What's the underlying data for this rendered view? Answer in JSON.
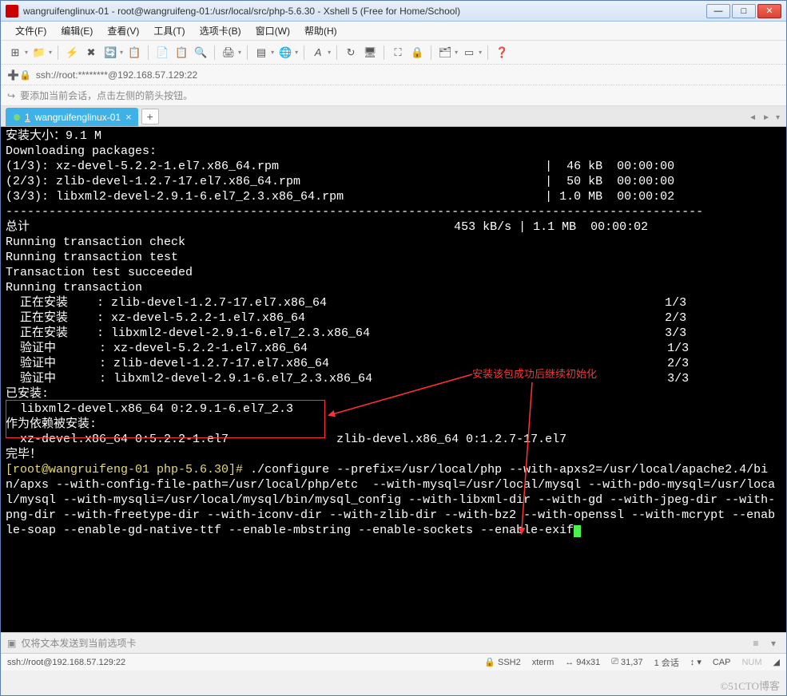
{
  "window": {
    "title": "wangruifenglinux-01 - root@wangruifeng-01:/usr/local/src/php-5.6.30 - Xshell 5 (Free for Home/School)"
  },
  "menu": {
    "file": "文件(F)",
    "edit": "编辑(E)",
    "view": "查看(V)",
    "tools": "工具(T)",
    "options": "选项卡(B)",
    "window": "窗口(W)",
    "help": "帮助(H)"
  },
  "address": "ssh://root:********@192.168.57.129:22",
  "hint": "要添加当前会话，点击左侧的箭头按钮。",
  "tab": {
    "index": "1",
    "label": "wangruifenglinux-01"
  },
  "terminal_lines": {
    "l1": "安装大小：9.1 M",
    "l2": "Downloading packages:",
    "l3": "(1/3): xz-devel-5.2.2-1.el7.x86_64.rpm                                     |  46 kB  00:00:00",
    "l4": "(2/3): zlib-devel-1.2.7-17.el7.x86_64.rpm                                  |  50 kB  00:00:00",
    "l5": "(3/3): libxml2-devel-2.9.1-6.el7_2.3.x86_64.rpm                            | 1.0 MB  00:00:02",
    "dash": "-------------------------------------------------------------------------------------------------",
    "l6": "总计                                                           453 kB/s | 1.1 MB  00:00:02",
    "l7": "Running transaction check",
    "l8": "Running transaction test",
    "l9": "Transaction test succeeded",
    "l10": "Running transaction",
    "l11": "  正在安装    : zlib-devel-1.2.7-17.el7.x86_64                                               1/3",
    "l12": "  正在安装    : xz-devel-5.2.2-1.el7.x86_64                                                  2/3",
    "l13": "  正在安装    : libxml2-devel-2.9.1-6.el7_2.3.x86_64                                         3/3",
    "l14": "  验证中      : xz-devel-5.2.2-1.el7.x86_64                                                  1/3",
    "l15": "  验证中      : zlib-devel-1.2.7-17.el7.x86_64                                               2/3",
    "l16": "  验证中      : libxml2-devel-2.9.1-6.el7_2.3.x86_64                                         3/3",
    "l17": "",
    "l18": "已安装:",
    "l19": "  libxml2-devel.x86_64 0:2.9.1-6.el7_2.3",
    "l20": "",
    "l21": "作为依赖被安装:",
    "l22": "  xz-devel.x86_64 0:5.2.2-1.el7               zlib-devel.x86_64 0:1.2.7-17.el7",
    "l23": "",
    "l24": "完毕！",
    "prompt": "[root@wangruifeng-01 php-5.6.30]# ",
    "cmd": "./configure --prefix=/usr/local/php --with-apxs2=/usr/local/apache2.4/bin/apxs --with-config-file-path=/usr/local/php/etc  --with-mysql=/usr/local/mysql --with-pdo-mysql=/usr/local/mysql --with-mysqli=/usr/local/mysql/bin/mysql_config --with-libxml-dir --with-gd --with-jpeg-dir --with-png-dir --with-freetype-dir --with-iconv-dir --with-zlib-dir --with-bz2 --with-openssl --with-mcrypt --enable-soap --enable-gd-native-ttf --enable-mbstring --enable-sockets --enable-exif"
  },
  "annotation": "安装该包成功后继续初始化",
  "sendbar": "仅将文本发送到当前选项卡",
  "status": {
    "conn": "ssh://root@192.168.57.129:22",
    "proto": "SSH2",
    "term": "xterm",
    "size": "94x31",
    "pos": "31,37",
    "session": "1 会话",
    "cap": "CAP"
  },
  "watermark": "©51CTO博客"
}
